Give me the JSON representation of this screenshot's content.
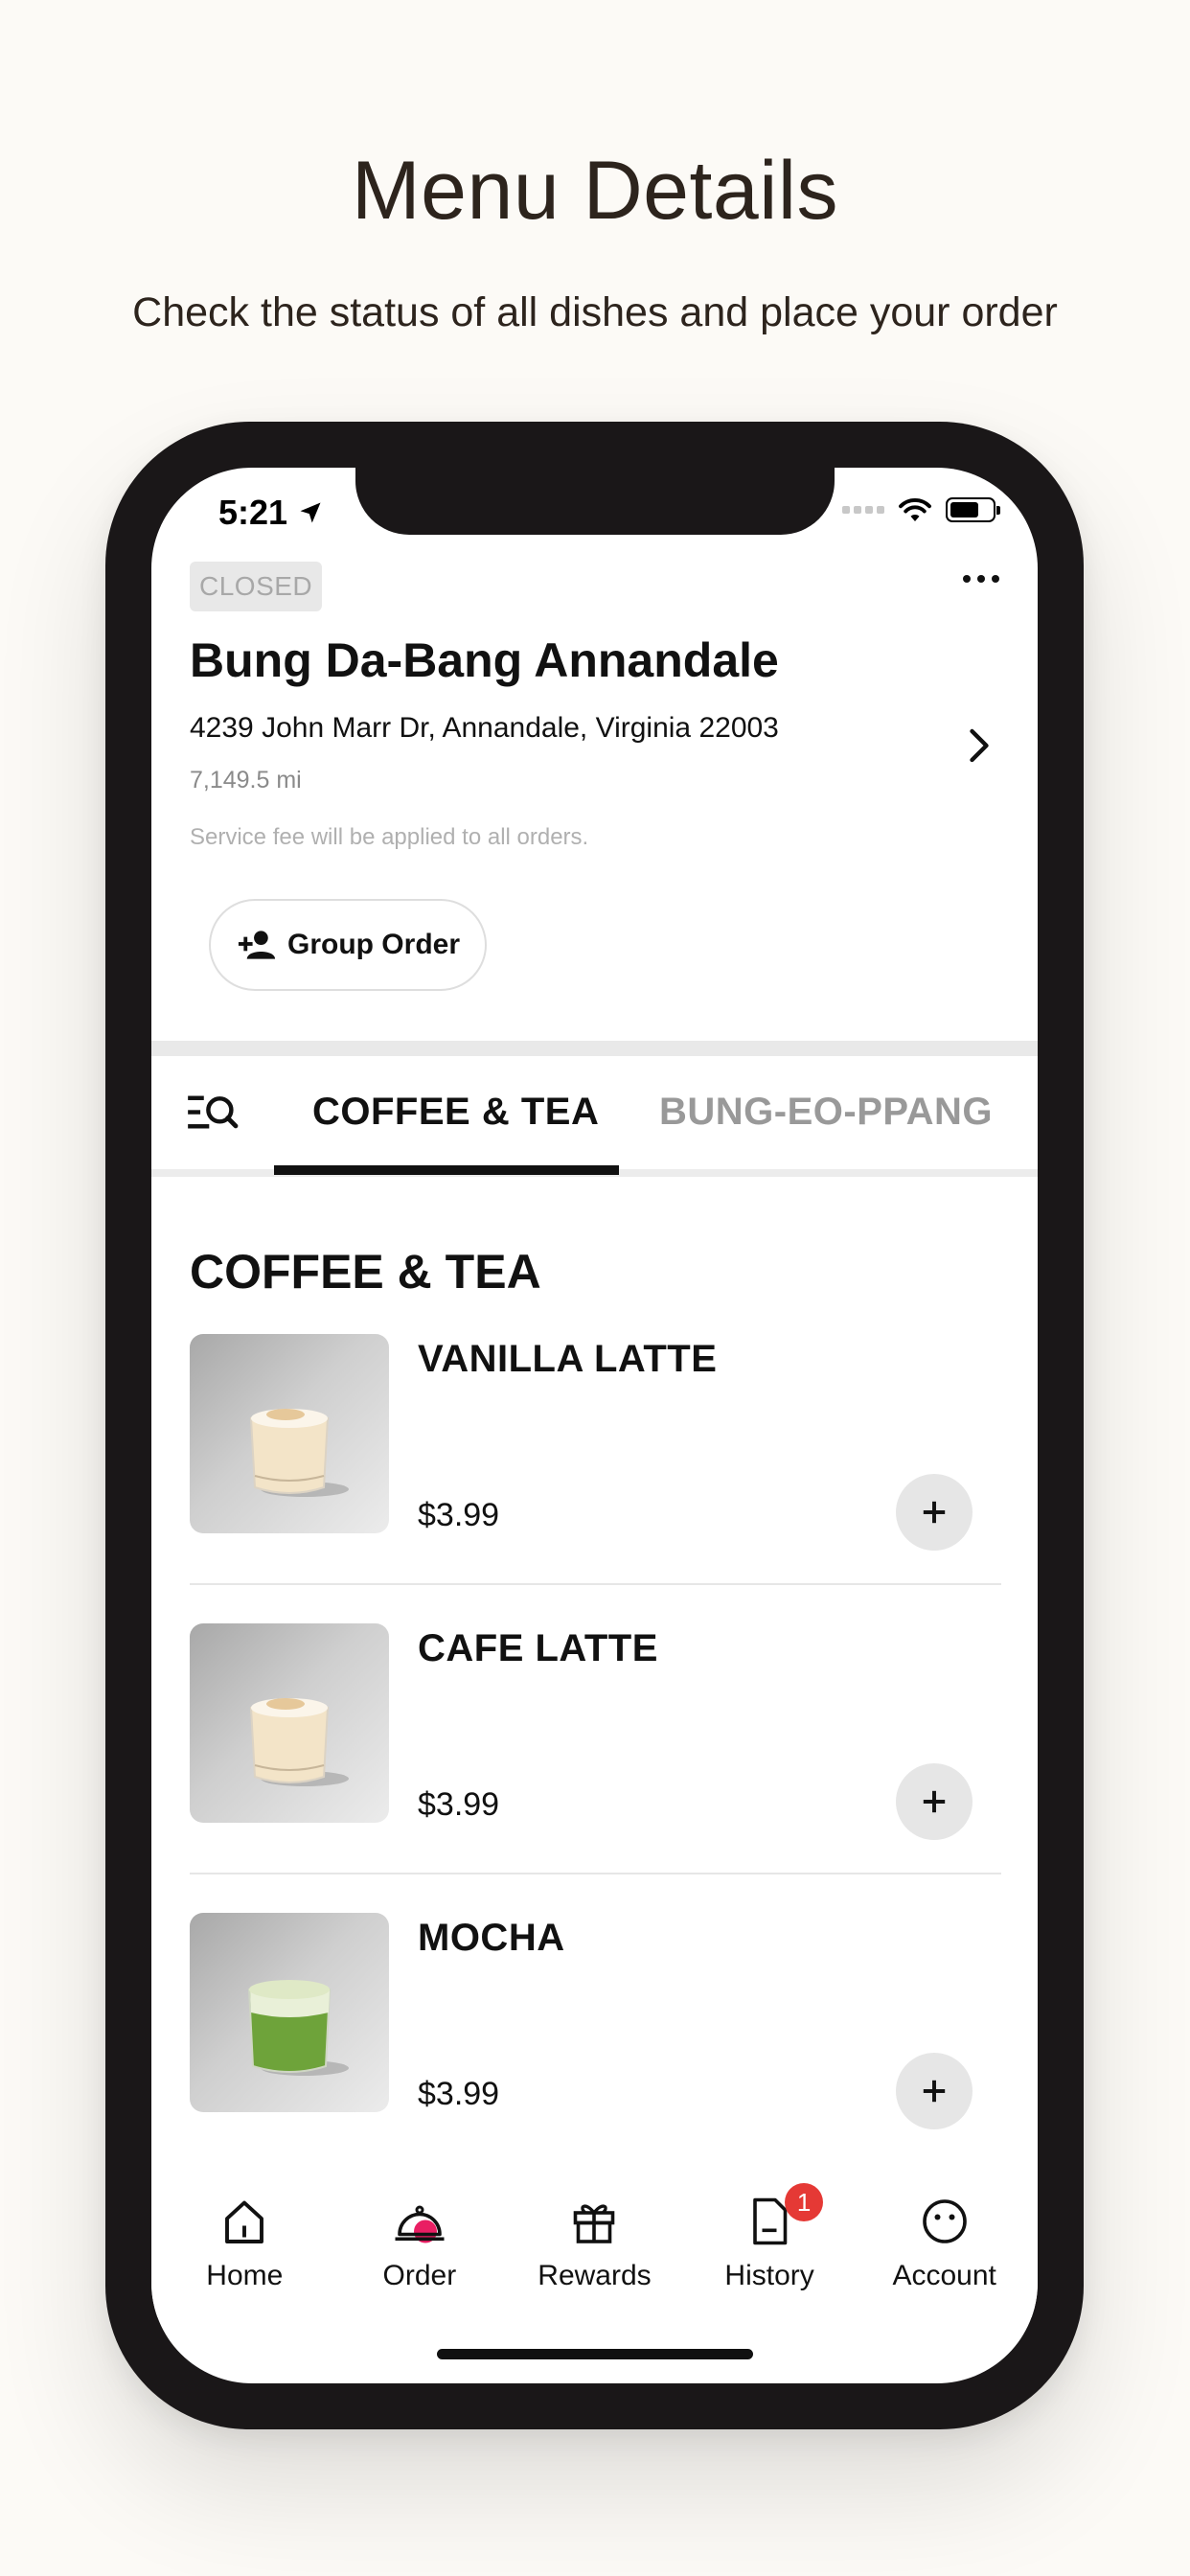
{
  "promo": {
    "title": "Menu Details",
    "subtitle": "Check the status of all dishes and place your order"
  },
  "status_bar": {
    "time": "5:21"
  },
  "store": {
    "status_badge": "CLOSED",
    "name": "Bung Da-Bang Annandale",
    "address": "4239 John Marr Dr, Annandale, Virginia 22003",
    "distance": "7,149.5 mi",
    "service_note": "Service fee will be applied to all orders.",
    "group_order_label": "Group Order"
  },
  "tabs": [
    {
      "label": "COFFEE & TEA",
      "active": true
    },
    {
      "label": "BUNG-EO-PPANG",
      "active": false
    }
  ],
  "section": {
    "title": "COFFEE & TEA"
  },
  "menu_items": [
    {
      "name": "VANILLA LATTE",
      "price": "$3.99",
      "image": "vanilla-latte-photo"
    },
    {
      "name": "CAFE LATTE",
      "price": "$3.99",
      "image": "cafe-latte-photo"
    },
    {
      "name": "MOCHA",
      "price": "$3.99",
      "image": "mocha-photo"
    }
  ],
  "bottom_nav": [
    {
      "label": "Home",
      "icon": "home-icon"
    },
    {
      "label": "Order",
      "icon": "order-cloche-icon"
    },
    {
      "label": "Rewards",
      "icon": "gift-icon"
    },
    {
      "label": "History",
      "icon": "document-icon",
      "badge": "1"
    },
    {
      "label": "Account",
      "icon": "face-icon"
    }
  ],
  "colors": {
    "background": "#fcfaf6",
    "phone_frame": "#1a1718",
    "accent_pink": "#e91e63",
    "badge_red": "#e53935"
  }
}
